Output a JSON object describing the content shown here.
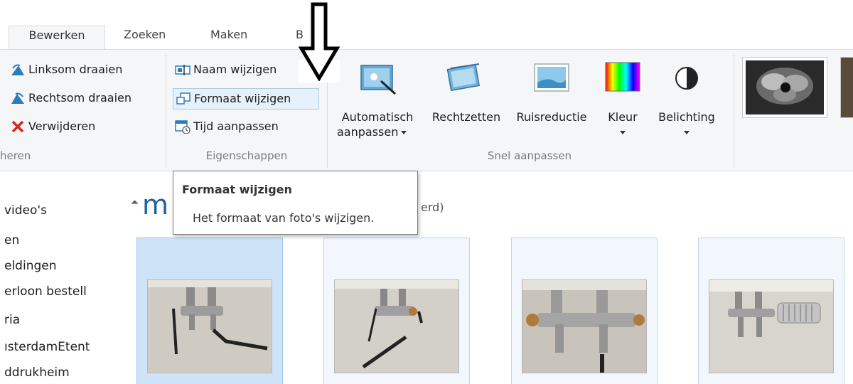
{
  "tabs": [
    {
      "label": "Bewerken",
      "active": true
    },
    {
      "label": "Zoeken",
      "active": false
    },
    {
      "label": "Maken",
      "active": false
    },
    {
      "label": "B",
      "active": false
    }
  ],
  "ribbon": {
    "organize": {
      "label": "heren",
      "rotate_left": "Linksom draaien",
      "rotate_right": "Rechtsom draaien",
      "delete": "Verwijderen"
    },
    "properties": {
      "label": "Eigenschappen",
      "rename": "Naam wijzigen",
      "resize": "Formaat wijzigen",
      "adjust_time": "Tijd aanpassen"
    },
    "quick_fix": {
      "label": "Snel aanpassen",
      "auto_adjust_line1": "Automatisch",
      "auto_adjust_line2": "aanpassen",
      "straighten": "Rechtzetten",
      "noise": "Ruisreductie",
      "color": "Kleur",
      "exposure": "Belichting"
    }
  },
  "tooltip": {
    "title": "Formaat wijzigen",
    "description": "Het formaat van foto's wijzigen."
  },
  "nav": {
    "items": [
      "video's",
      "en",
      "eldingen",
      "erloon bestell",
      "ria",
      "ısterdamEtent",
      "ddrukheim"
    ]
  },
  "content": {
    "folder_initial": "m",
    "folder_sub": "erd)"
  },
  "colors": {
    "accent": "#1e5fa8",
    "selected_thumb": "#cfe3f8",
    "hover_border": "#aacbe6",
    "ribbon_bg": "#f5f6f7"
  },
  "icons": {
    "rotate_left": "rotate-left-icon",
    "rotate_right": "rotate-right-icon",
    "delete": "red-x-icon",
    "rename": "rename-icon",
    "resize": "resize-icon",
    "adjust_time": "calendar-clock-icon",
    "auto_adjust": "magic-wand-photo-icon",
    "straighten": "straighten-photo-icon",
    "noise": "landscape-photo-icon",
    "color": "color-spectrum-icon",
    "exposure": "half-circle-contrast-icon",
    "annotation": "down-arrow-icon"
  }
}
